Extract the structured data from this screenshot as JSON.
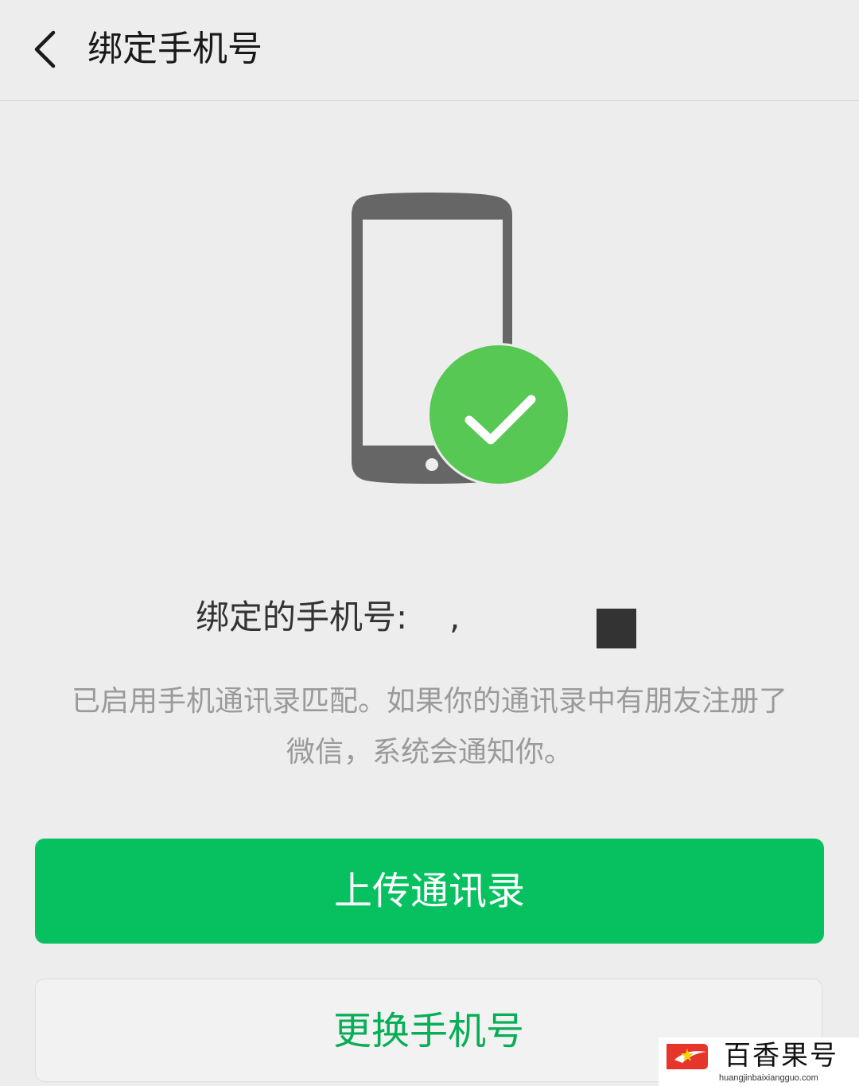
{
  "header": {
    "back_icon": "chevron-left-icon",
    "title": "绑定手机号"
  },
  "illustration": {
    "phone_icon": "smartphone-icon",
    "badge_icon": "checkmark-circle-icon",
    "phone_color": "#666666",
    "badge_color": "#56c853"
  },
  "bound_phone": {
    "label": "绑定的手机号:",
    "value": ","
  },
  "description": {
    "line1": "已启用手机通讯录匹配。如果你的通讯录中有朋友注册了",
    "line2": "微信，系统会通知你。"
  },
  "actions": {
    "upload_contacts": "上传通讯录",
    "change_phone": "更换手机号"
  },
  "watermark": {
    "title": "百香果号",
    "url": "huangjinbaixiangguo.com"
  },
  "colors": {
    "background": "#ededed",
    "primary_button": "#07c160",
    "secondary_text": "#06ae56"
  }
}
